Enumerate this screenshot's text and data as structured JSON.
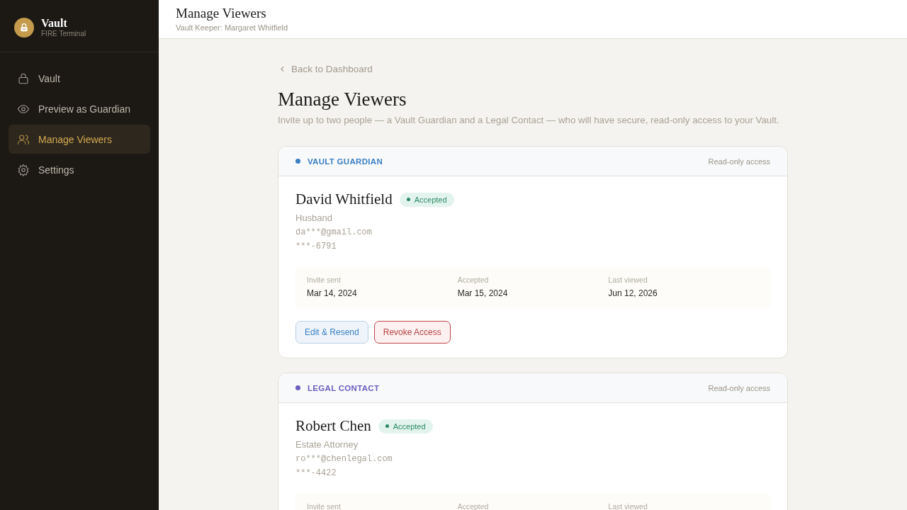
{
  "brand": {
    "title": "Vault",
    "subtitle": "FIRE Terminal"
  },
  "sidebar": {
    "items": [
      {
        "label": "Vault",
        "kind": "lock",
        "selected": false
      },
      {
        "label": "Preview as Guardian",
        "kind": "eye",
        "selected": false
      },
      {
        "label": "Manage Viewers",
        "kind": "users",
        "selected": true
      },
      {
        "label": "Settings",
        "kind": "gear",
        "selected": false
      }
    ]
  },
  "header": {
    "title": "Manage Viewers",
    "subtitle": "Vault Keeper: Margaret Whitfield"
  },
  "back_link": "Back to Dashboard",
  "page": {
    "title": "Manage Viewers",
    "description": "Invite up to two people — a Vault Guardian and a Legal Contact — who will have secure, read-only access to your Vault."
  },
  "viewers": [
    {
      "role": "VAULT GUARDIAN",
      "color": "#3b7fc4",
      "access": "Read-only access",
      "name": "David Whitfield",
      "status": {
        "label": "Accepted",
        "kind": "accepted"
      },
      "relation": "Husband",
      "email": "da***@gmail.com",
      "phone": "***-6791",
      "stats": [
        {
          "label": "Invite sent",
          "value": "Mar 14, 2024"
        },
        {
          "label": "Accepted",
          "value": "Mar 15, 2024"
        },
        {
          "label": "Last viewed",
          "value": "Jun 12, 2026"
        }
      ],
      "actions": [
        {
          "label": "Edit & Resend",
          "kind": "edit"
        },
        {
          "label": "Revoke Access",
          "kind": "revoke"
        }
      ]
    },
    {
      "role": "LEGAL CONTACT",
      "color": "#6b5fc0",
      "access": "Read-only access",
      "name": "Robert Chen",
      "status": {
        "label": "Accepted",
        "kind": "accepted"
      },
      "relation": "Estate Attorney",
      "email": "ro***@chenlegal.com",
      "phone": "***-4422",
      "stats": [
        {
          "label": "Invite sent"
        },
        {
          "label": "Accepted"
        },
        {
          "label": "Last viewed"
        }
      ]
    }
  ]
}
